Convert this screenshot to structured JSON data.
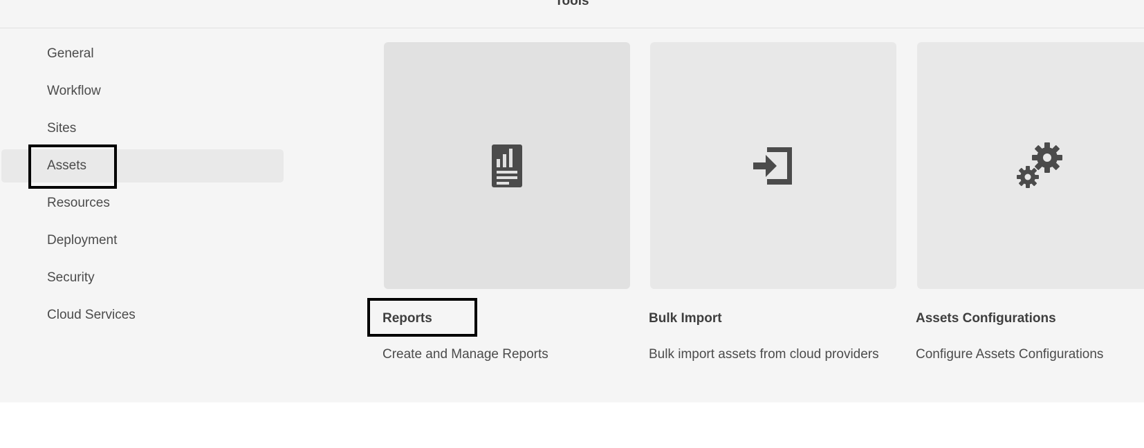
{
  "header": {
    "title": "Tools"
  },
  "sidebar": {
    "items": [
      {
        "label": "General"
      },
      {
        "label": "Workflow"
      },
      {
        "label": "Sites"
      },
      {
        "label": "Assets"
      },
      {
        "label": "Resources"
      },
      {
        "label": "Deployment"
      },
      {
        "label": "Security"
      },
      {
        "label": "Cloud Services"
      }
    ],
    "selected": "Assets"
  },
  "cards": [
    {
      "title": "Reports",
      "description": "Create and Manage Reports",
      "icon": "report-icon"
    },
    {
      "title": "Bulk Import",
      "description": "Bulk import assets from cloud providers",
      "icon": "import-icon"
    },
    {
      "title": "Assets Configurations",
      "description": "Configure Assets Configurations",
      "icon": "gears-icon"
    }
  ],
  "colors": {
    "background": "#f5f5f5",
    "selected_item": "#e9e9e9",
    "card_thumbnail": "#e8e8e8",
    "icon": "#4b4b4b",
    "highlight_border": "#000000"
  }
}
